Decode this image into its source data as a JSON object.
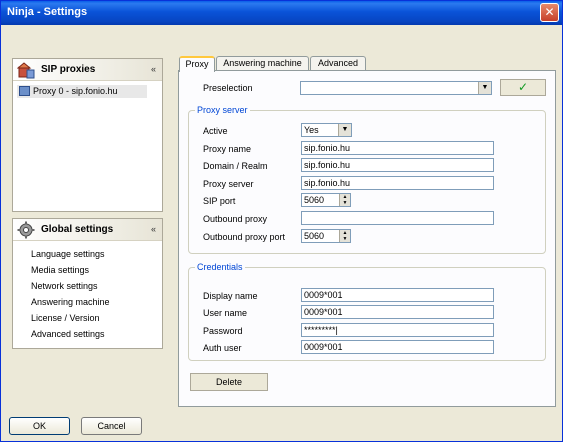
{
  "window": {
    "title": "Ninja - Settings",
    "close_glyph": "✕"
  },
  "sip_panel": {
    "title": "SIP proxies",
    "collapse_glyph": "«",
    "items": [
      {
        "label": "Proxy 0 -   sip.fonio.hu"
      }
    ]
  },
  "global_panel": {
    "title": "Global settings",
    "collapse_glyph": "«",
    "items": [
      {
        "label": "Language settings"
      },
      {
        "label": "Media settings"
      },
      {
        "label": "Network settings"
      },
      {
        "label": "Answering machine"
      },
      {
        "label": "License / Version"
      },
      {
        "label": "Advanced settings"
      }
    ]
  },
  "tabs": [
    {
      "label": "Proxy"
    },
    {
      "label": "Answering machine"
    },
    {
      "label": "Advanced"
    }
  ],
  "preselection": {
    "label": "Preselection",
    "value": "",
    "apply_glyph": "✓"
  },
  "proxy_server": {
    "title": "Proxy server",
    "active_label": "Active",
    "active_value": "Yes",
    "proxy_name_label": "Proxy name",
    "proxy_name_value": "sip.fonio.hu",
    "domain_label": "Domain / Realm",
    "domain_value": "sip.fonio.hu",
    "server_label": "Proxy server",
    "server_value": "sip.fonio.hu",
    "sip_port_label": "SIP port",
    "sip_port_value": "5060",
    "outbound_label": "Outbound proxy",
    "outbound_value": "",
    "outbound_port_label": "Outbound proxy port",
    "outbound_port_value": "5060"
  },
  "credentials": {
    "title": "Credentials",
    "display_name_label": "Display name",
    "display_name_value": "0009*001",
    "user_name_label": "User name",
    "user_name_value": "0009*001",
    "password_label": "Password",
    "password_value": "*********|",
    "auth_user_label": "Auth user",
    "auth_user_value": "0009*001"
  },
  "buttons": {
    "delete": "Delete",
    "ok": "OK",
    "cancel": "Cancel"
  },
  "icons": {
    "sip_panel_icon": "server-icon",
    "global_panel_icon": "gear-icon"
  }
}
